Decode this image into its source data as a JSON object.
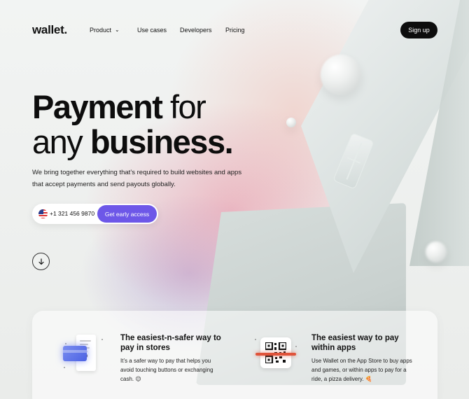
{
  "header": {
    "logo": "wallet.",
    "nav": [
      {
        "label": "Product",
        "has_dropdown": true
      },
      {
        "label": "Use cases"
      },
      {
        "label": "Developers"
      },
      {
        "label": "Pricing"
      }
    ],
    "signup_label": "Sign up"
  },
  "hero": {
    "title_line1_bold": "Payment",
    "title_line1_light": " for",
    "title_line2_light": "any ",
    "title_line2_bold": "business.",
    "subtitle": "We bring together everything that’s required to build websites and apps that accept payments and send payouts globally.",
    "phone": "+1 321 456 9870",
    "cta_label": "Get early access"
  },
  "features": [
    {
      "title": "The easiest-n-safer way to pay in stores",
      "description": "It’s a safer way to pay that helps you avoid touching buttons or exchanging cash. 😉"
    },
    {
      "title": "The easiest way to pay within apps",
      "description": "Use Wallet on the App Store to buy apps and games, or within apps to pay for a ride, a pizza delivery. 🍕"
    }
  ],
  "icons": {
    "scroll_down": "arrow-down-icon",
    "dropdown": "chevron-down-icon",
    "flag": "us-flag-icon"
  },
  "colors": {
    "accent": "#6d57e8",
    "dark": "#0d0d0d",
    "scan_red": "#e0533a",
    "card_blue": "#4c62e3"
  }
}
